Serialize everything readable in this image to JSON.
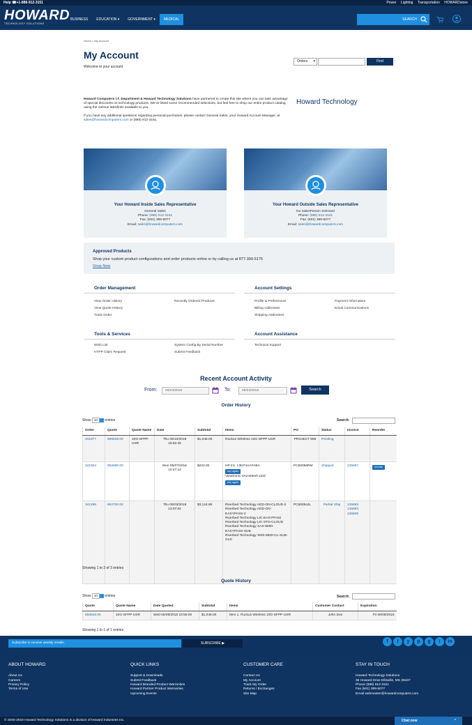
{
  "topbar": {
    "help": "Help ☎+1-888-912-3151",
    "links": [
      "Power",
      "Lighting",
      "Transportation",
      "HOWARDstore"
    ]
  },
  "header": {
    "logo": "HOWARD",
    "logo_sub": "TECHNOLOGY SOLUTIONS",
    "nav": [
      "BUSINESS",
      "EDUCATION ▾",
      "GOVERNMENT ▾",
      "MEDICAL"
    ],
    "search_label": "SEARCH"
  },
  "breadcrumb": "Home > My Account",
  "page": {
    "title": "My Account",
    "welcome": "Welcome to your account",
    "orders_select": "Orders",
    "find_label": "Find"
  },
  "intro": {
    "p1_bold": "Howard Computers I.T. Department & Howard Technology Solutions",
    "p1_rest": " have partnered to create this site where you can take advantage of special discounts on technology products. We've listed some recommended selections, but feel free to shop our entire product catalog using the various tabs/links available to you.",
    "p2_a": "If you have any additional questions regarding personal purchases, please contact General Sales, your Howard Account Manager, at ",
    "p2_email": "sales@howardcomputers.com",
    "p2_b": " or (888) 912-3151.",
    "brand": "Howard Technology"
  },
  "reps": {
    "inside": {
      "heading": "Your Howard Inside Sales Representative",
      "name": "General Sales",
      "phone_label": "Phone:",
      "phone": "(888) 912-3151",
      "fax": "Fax: (601) 399-5077",
      "email_label": "Email:",
      "email": "sales@howardcomputers.com"
    },
    "outside": {
      "heading": "Your Howard Outside Sales Representative",
      "name": "No SalesPerson Selected",
      "phone_label": "Phone:",
      "phone": "(888) 912-3151",
      "fax": "Fax: (601) 399-5077",
      "email_label": "Email:",
      "email": "sales@howardcomputers.com"
    }
  },
  "approved": {
    "heading": "Approved Products",
    "text": "Shop your custom product configurations and order products online or by calling us at 877-399-5175",
    "link": "Shop Now"
  },
  "sections": {
    "order_mgmt": {
      "heading": "Order Management",
      "col1": [
        "View Order History",
        "View Quote History",
        "Track Order"
      ],
      "col2": [
        "Recently Ordered Products"
      ]
    },
    "account_settings": {
      "heading": "Account Settings",
      "col1": [
        "Profile & Preferences",
        "Billing Addresses",
        "Shipping Addresses"
      ],
      "col2": [
        "Payment Information",
        "Email Communications"
      ]
    },
    "tools": {
      "heading": "Tools & Services",
      "col1": [
        "Wish List",
        "HTPP Claim Request"
      ],
      "col2": [
        "System Config By Serial Number",
        "Submit Feedback"
      ]
    },
    "assistance": {
      "heading": "Account Assistance",
      "col1": [
        "Technical Support"
      ]
    }
  },
  "activity": {
    "title": "Recent Account Activity",
    "from_label": "From:",
    "from": "04/24/2018",
    "to_label": "To:",
    "to": "05/24/2018",
    "search": "Search"
  },
  "order_history": {
    "title": "Order History",
    "show": "Show",
    "entries_count": "10",
    "entries": "entries",
    "search_label": "Search:",
    "columns": [
      "Order",
      "Quote",
      "Quote Name",
      "Date",
      "Subtotal",
      "Items",
      "PO",
      "Status",
      "Invoice",
      "Reorder"
    ],
    "rows": [
      {
        "order": "341977",
        "quote": "856528.00",
        "quote_name": "10G-SFPP-USR",
        "date": "Thu 05/10/2018 16:52:45",
        "subtotal": "$1,048.00",
        "items": [
          "Ruckus Wireless 10G-SFPP-USR"
        ],
        "po": "PROJECT 968",
        "status": "Pending",
        "invoice": [],
        "reorder": ""
      },
      {
        "order": "341564",
        "quote": "852680.00",
        "quote_name": "",
        "date": "Mon 05/07/2018 10:47:14",
        "subtotal": "$223.00",
        "items": [
          "HP Inc. L3N74AA#ABA",
          "ViewSonic VA2446mh-LED"
        ],
        "po": "PC50056RM",
        "status": "Shipped",
        "invoice": [
          "135997"
        ],
        "reorder": "reorder",
        "buy_again": "buy again"
      },
      {
        "order": "341269",
        "quote": "852720.00",
        "quote_name": "",
        "date": "Thu 05/03/2018 13:07:02",
        "subtotal": "$3,124.80",
        "items": [
          "Riverbed Technology ADD-ON-CLOUD-2",
          "Riverbed Technology ADD-ON-EASYPASS-2",
          "Riverbed Technology LIC-EASYPASS",
          "Riverbed Technology LIC-STD-CLOUD",
          "Riverbed Technology XAS-9000-EASYPASS-SUB",
          "Riverbed Technology XMS-9500-CL-SUB-GLD"
        ],
        "po": "PC50054JL",
        "status": "Partial Ship",
        "invoice": [
          "135993",
          "135993",
          "135906"
        ],
        "reorder": ""
      }
    ],
    "footer": "Showing 1 to 3 of 3 entries"
  },
  "quote_history": {
    "title": "Quote History",
    "show": "Show",
    "entries_count": "10",
    "entries": "entries",
    "search_label": "Search:",
    "columns": [
      "Quote",
      "Quote Name",
      "Date Quoted",
      "Subtotal",
      "Items",
      "Customer Contact",
      "Expiration"
    ],
    "rows": [
      {
        "quote": "856528.00",
        "quote_name": "10G-SFPP-USR",
        "date": "Wed 05/09/2018 10:56:00",
        "subtotal": "$1,048.00",
        "items": "Item 1. Ruckus Wireless 10G-SFPP-USR",
        "contact": "John Doe",
        "expiration": "Fri 06/08/2018"
      }
    ],
    "footer": "Showing 1 to 1 of 1 entries"
  },
  "footer": {
    "subscribe_placeholder": "Subscribe to receive weekly emails.",
    "subscribe_btn": "SUBSCRIBE ▶",
    "social": [
      "f",
      "t",
      "y",
      "p",
      "g",
      "i",
      "in"
    ],
    "cols": [
      {
        "heading": "ABOUT HOWARD",
        "items": [
          "About Us",
          "Careers",
          "Privacy Policy",
          "Terms of Use"
        ]
      },
      {
        "heading": "QUICK LINKS",
        "items": [
          "Support & Downloads",
          "Submit Feedback",
          "Howard Branded Product Warranties",
          "Howard Partner Product Warranties",
          "Upcoming Events"
        ]
      },
      {
        "heading": "CUSTOMER CARE",
        "items": [
          "Contact Us",
          "My Account",
          "Track My Order",
          "Returns / Exchanges",
          "Site Map"
        ]
      },
      {
        "heading": "STAY IN TOUCH",
        "items": [
          "Howard Technology Solutions",
          "36 Howard Drive Ellisville, MS 39437",
          "Phone (888) 912-3151",
          "Fax (601) 399-5077",
          "Email webmaster@howardcomputers.com"
        ]
      }
    ],
    "copyright": "© 2000-2018 Howard Technology Solutions is a division of Howard Industries Inc.",
    "chat": "Chat now"
  }
}
